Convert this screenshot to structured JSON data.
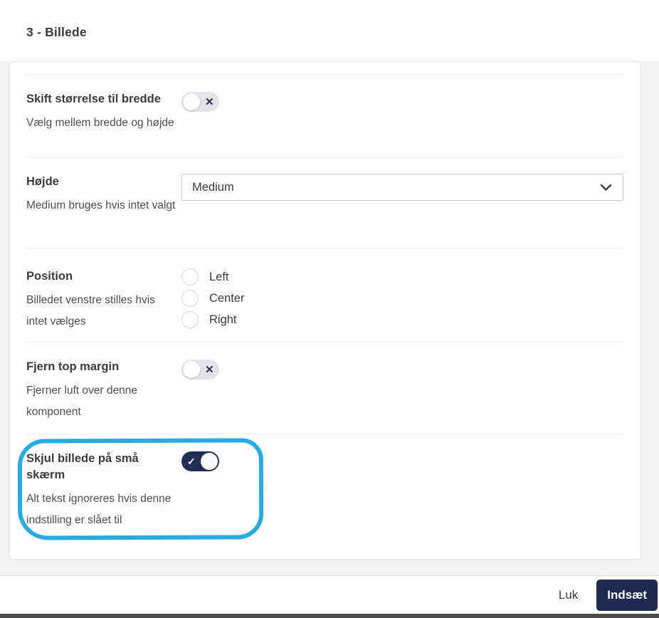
{
  "modal": {
    "title": "3 - Billede",
    "rows": [
      {
        "control": "toggle",
        "label": "Skift størrelse til bredde",
        "description": "Vælg mellem bredde og højde",
        "state": "off"
      },
      {
        "control": "select",
        "label": "Højde",
        "description": "Medium bruges hvis intet valgt",
        "value": "Medium"
      },
      {
        "control": "radio-group",
        "label": "Position",
        "description": "Billedet venstre stilles hvis intet vælges",
        "options": [
          "Left",
          "Center",
          "Right"
        ],
        "selected": ""
      },
      {
        "control": "toggle",
        "label": "Fjern top margin",
        "description": "Fjerner luft over denne komponent",
        "state": "off"
      },
      {
        "control": "toggle",
        "label": "Skjul billede på små skærm",
        "description": "Alt tekst ignoreres hvis denne indstilling er slået til",
        "state": "on",
        "highlighted": true
      }
    ],
    "footer": {
      "close_label": "Luk",
      "submit_label": "Indsæt"
    }
  },
  "icons": {
    "toggle_off_glyph": "✕",
    "toggle_on_glyph": "✓"
  },
  "colors": {
    "accent_navy": "#1f2a50",
    "toggle_on_bg": "#222e52",
    "toggle_off_bg": "#e3e3e8",
    "annotation_highlight": "#29abe2",
    "page_background": "#f4f3f4"
  },
  "annotation": {
    "type": "hand-drawn-rounded-rectangle",
    "target": "Skjul billede på små skærm"
  }
}
